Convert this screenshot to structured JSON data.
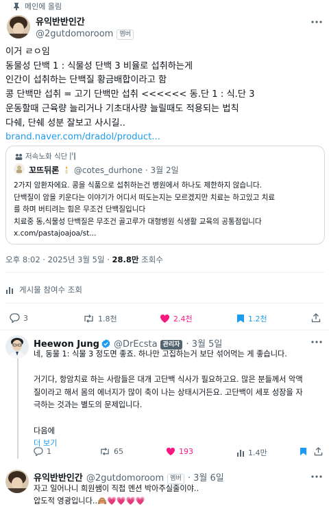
{
  "context": {
    "pinned_label": "메인에 올림"
  },
  "main_tweet": {
    "author_name": "유익반반인간",
    "handle": "@2gutdomoroom",
    "badge": "멤버",
    "lines": [
      "이거 ㄹㅇ임",
      "동물성 단백 1 :  식물성 단백 3 비율로 섭취하는게",
      "인간이 섭취하는 단백질 황금배합이라고 함",
      "콩 단백만 섭취 = 고기 단백만 섭취 <<<<<< 동.단 1 : 식.단 3",
      "운동할때 근육량 늘리거나 기초대사량 늘릴때도 적용되는 법칙",
      "다쉐, 단쉐 성분 잘보고 사시길.."
    ],
    "link": "brand.naver.com/dradol/product...",
    "timestamp": "오후 8:02 · 2025년 3월 5일 · ",
    "views_count": "28.8만",
    "views_label": " 조회수",
    "engagement_label": "게시물 참여수 조회",
    "actions": {
      "replies": "3",
      "retweets": "1.8천",
      "likes": "2.4천",
      "bookmarks": "1.2천"
    }
  },
  "quoted_tweet": {
    "community": "저속노화 식단",
    "author_name": "꼬뜨뒤론",
    "handle": "@cotes_durhone",
    "date": "· 3월 2일",
    "lines": [
      "2가지 암환자에요. 콩을 식품으로 섭취하는건 병원에서 하나도 제한하지 않습니다.",
      "단백질이 암을 키운다는 이야기가 어디서 떠도는지는 모르겠지만 치료는 하고있고 치료",
      "를 하며 버티려는 힘은 무조건 단백질입니다",
      "치료중 동,식물성 단백질은 무조건 골고루가 대형병원 식생활 교육의 공통점입니다",
      "x.com/pastajoajoa/st..."
    ]
  },
  "reply_1": {
    "author_name": "Heewon Jung",
    "handle": "@DrEcsta",
    "badge": "관리자",
    "date": "· 3월 5일",
    "lines": [
      "네, 동물 1: 식물 3 정도면 좋죠. 하나만 고집하는거 보단 섞어먹는 게 좋습니다.",
      "",
      "거기다, 항암치료 하는 사람들은 대개 고단백 식사가 필요하고요. 많은 분들께서 악액",
      "질이라고 해서 몸의 에너지가 많이 축이 나는 상태시거든요. 고단백이 세포 성장을 자",
      "극하는 것과는 별도의 문제입니다.",
      "",
      "다음에"
    ],
    "show_more": "더 보기",
    "actions": {
      "replies": "1",
      "retweets": "65",
      "likes": "193",
      "views": "1.4만"
    }
  },
  "reply_2": {
    "author_name": "유익반반인간",
    "handle": "@2gutdomoroom",
    "badge": "멤버",
    "date": "· 3월 6일",
    "lines": [
      "자고 일어나니 희원쌤이 직접 멘션 박아주실줄이야..",
      "압도적 영광입니다.."
    ],
    "emoji": "🙈💗💗💗💗"
  },
  "colors": {
    "accent": "#1d9bf0",
    "like": "#f91880",
    "muted": "#536471",
    "border": "#eff3f4"
  }
}
